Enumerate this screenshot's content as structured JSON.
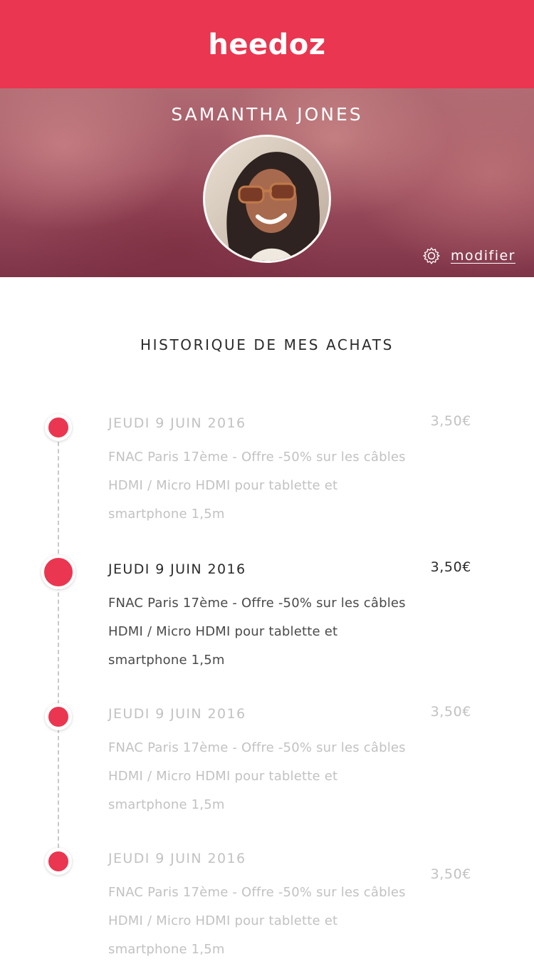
{
  "app": {
    "brand": "heedoz"
  },
  "profile": {
    "name": "SAMANTHA JONES",
    "edit_label": "modifier",
    "edit_icon": "gear-icon"
  },
  "history": {
    "title": "HISTORIQUE DE MES ACHATS",
    "entries": [
      {
        "date": "JEUDI 9 JUIN 2016",
        "description": "FNAC Paris 17ème -  Offre -50% sur les câbles HDMI / Micro HDMI pour tablette et smartphone 1,5m",
        "price": "3,50€",
        "active": false
      },
      {
        "date": "JEUDI 9 JUIN 2016",
        "description": "FNAC Paris 17ème -  Offre -50% sur les câbles HDMI / Micro HDMI pour tablette et smartphone 1,5m",
        "price": "3,50€",
        "active": true
      },
      {
        "date": "JEUDI 9 JUIN 2016",
        "description": "FNAC Paris 17ème -  Offre -50% sur les câbles HDMI / Micro HDMI pour tablette et smartphone 1,5m",
        "price": "3,50€",
        "active": false
      },
      {
        "date": "JEUDI 9 JUIN 2016",
        "description": "FNAC Paris 17ème -  Offre -50% sur les câbles HDMI / Micro HDMI pour tablette et smartphone 1,5m",
        "price": "3,50€",
        "active": false
      }
    ]
  },
  "colors": {
    "brand": "#ea3650",
    "muted_text": "#c2c2c2",
    "active_text": "#2b2b2b"
  }
}
